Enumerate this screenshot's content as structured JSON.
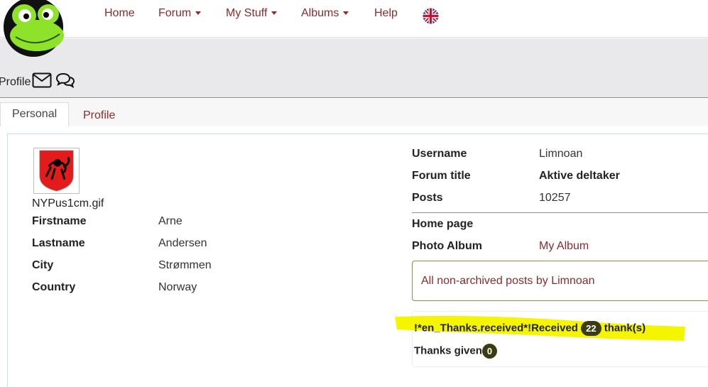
{
  "nav": {
    "home": "Home",
    "forum": "Forum",
    "my_stuff": "My Stuff",
    "albums": "Albums",
    "help": "Help"
  },
  "header": {
    "profile_label": "Profile"
  },
  "tabs": {
    "personal": "Personal",
    "profile": "Profile"
  },
  "avatar": {
    "filename": "NYPus1cm.gif"
  },
  "personal": {
    "firstname_label": "Firstname",
    "firstname_value": "Arne",
    "lastname_label": "Lastname",
    "lastname_value": "Andersen",
    "city_label": "City",
    "city_value": "Strømmen",
    "country_label": "Country",
    "country_value": "Norway"
  },
  "account": {
    "username_label": "Username",
    "username_value": "Limnoan",
    "forum_title_label": "Forum title",
    "forum_title_value": "Aktive deltaker",
    "posts_label": "Posts",
    "posts_value": "10257",
    "home_page_label": "Home page",
    "photo_album_label": "Photo Album",
    "photo_album_value": "My Album"
  },
  "posts_link": "All non-archived posts by Limnoan",
  "thanks": {
    "received_prefix": "!*en_Thanks.received*!Received",
    "received_count": "22",
    "received_suffix": "thank(s)",
    "given_label": "Thanks given",
    "given_count": "0"
  },
  "colors": {
    "link": "#8a2b2b",
    "badge": "#3c3c12",
    "highlight": "#f5f500"
  }
}
